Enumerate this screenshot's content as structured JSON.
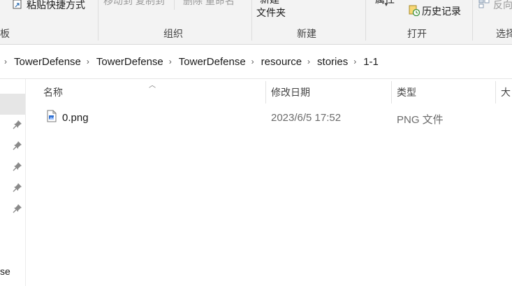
{
  "ribbon": {
    "clipboard": {
      "paste_shortcut": "粘贴快捷方式",
      "group_label_partial": "板"
    },
    "organize": {
      "move_copy_partial": "移动到 复制到",
      "delete_rename_partial": "删除 重命名",
      "group_label": "组织"
    },
    "new": {
      "new_item_partial": "新建",
      "new_folder_line2": "文件夹",
      "group_label": "新建"
    },
    "open": {
      "properties_partial": "属性",
      "history": "历史记录",
      "group_label": "打开"
    },
    "select": {
      "invert_partial": "反向",
      "group_label_partial": "选择"
    }
  },
  "breadcrumb": [
    "TowerDefense",
    "TowerDefense",
    "TowerDefense",
    "resource",
    "stories",
    "1-1"
  ],
  "nav": {
    "bottom_text_partial": "se"
  },
  "file_list": {
    "columns": {
      "name": "名称",
      "date_modified": "修改日期",
      "type": "类型",
      "size_partial": "大"
    },
    "rows": [
      {
        "name": "0.png",
        "date_modified": "2023/6/5 17:52",
        "type": "PNG 文件",
        "icon": "png-file-icon"
      }
    ]
  }
}
